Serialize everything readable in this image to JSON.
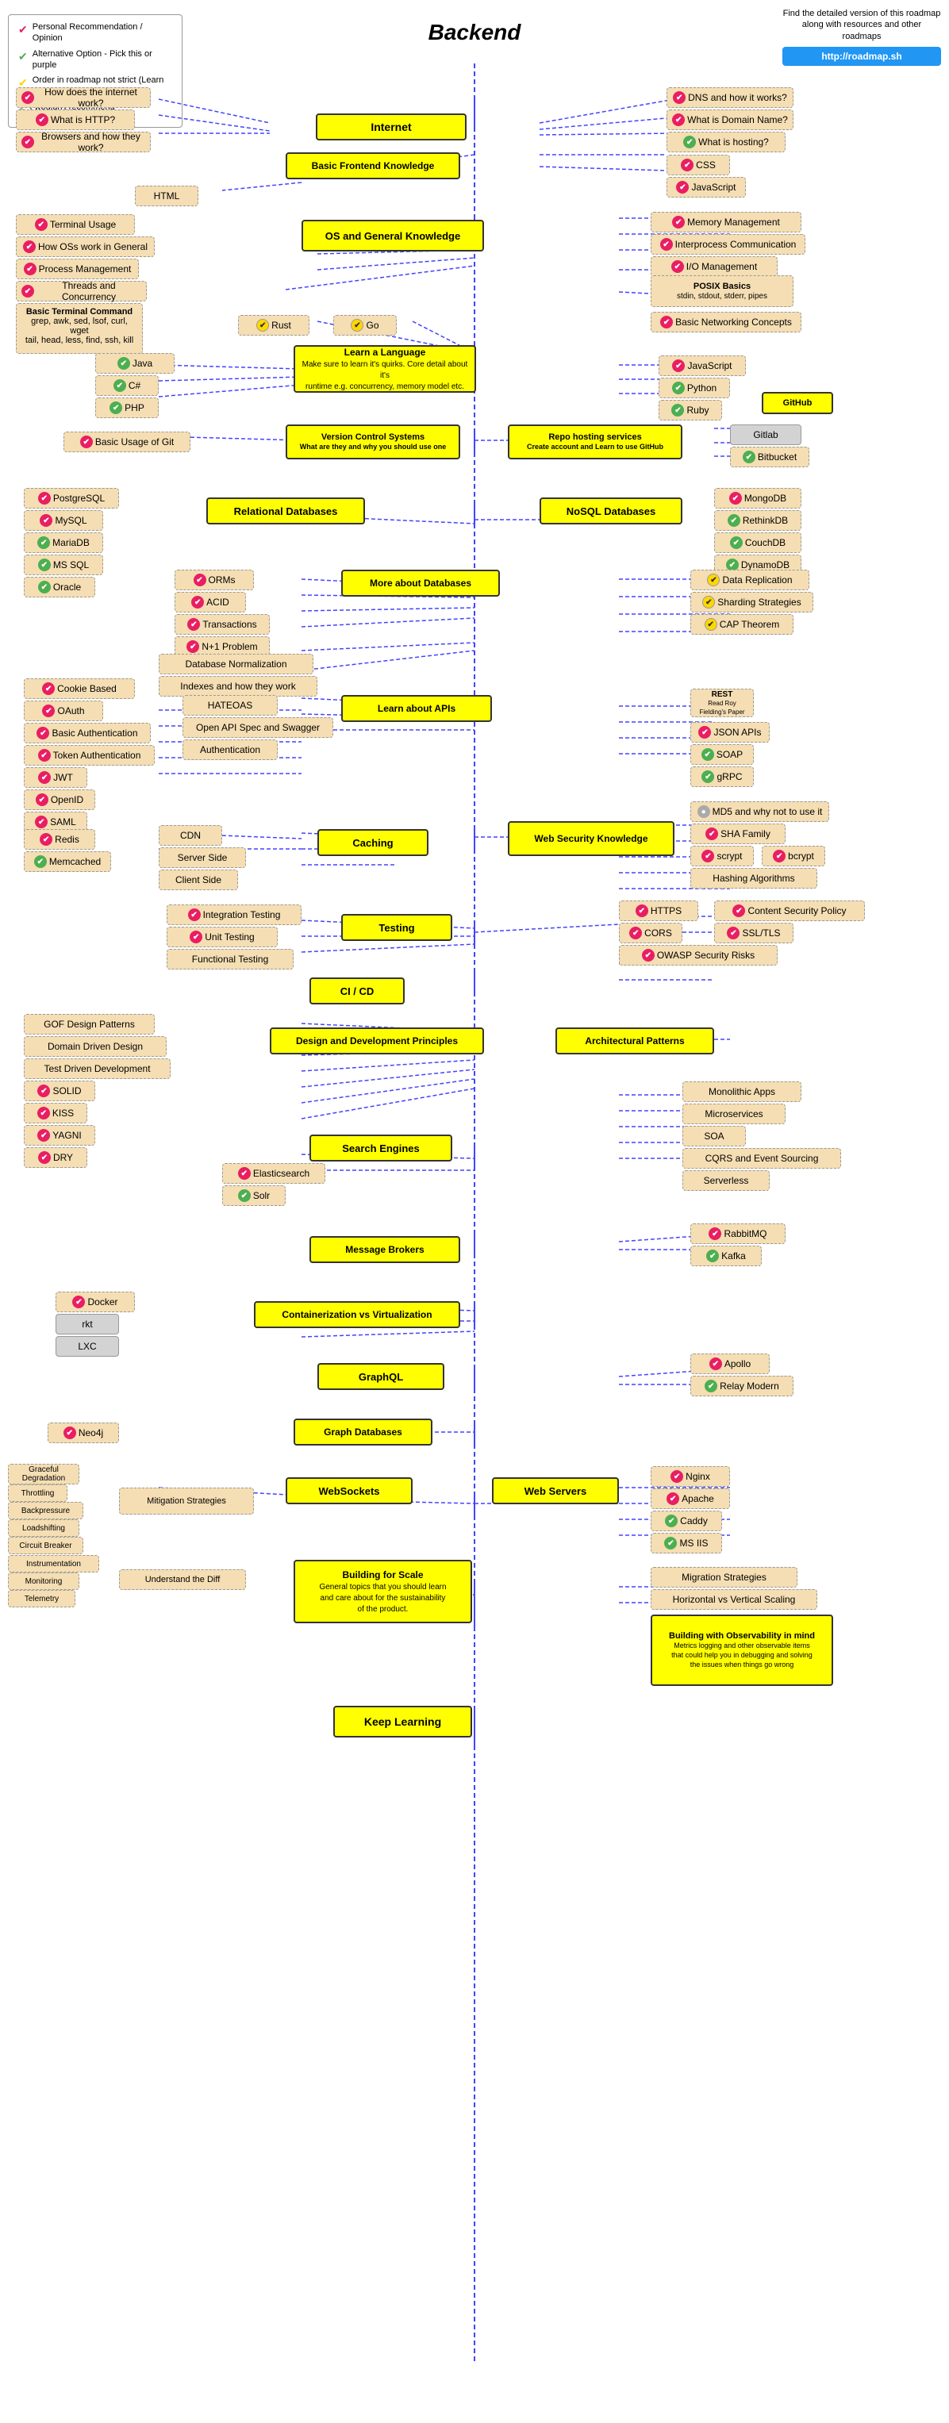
{
  "title": "Backend",
  "info": {
    "description": "Find the detailed version of this roadmap along with resources and other roadmaps",
    "url": "http://roadmap.sh"
  },
  "legend": {
    "items": [
      {
        "icon": "pink-check",
        "text": "Personal Recommendation / Opinion"
      },
      {
        "icon": "green-check",
        "text": "Alternative Option - Pick this or purple"
      },
      {
        "icon": "order",
        "text": "Order in roadmap not strict (Learn anytime)"
      },
      {
        "icon": "gray",
        "text": "I wouldn't recommend"
      }
    ]
  }
}
